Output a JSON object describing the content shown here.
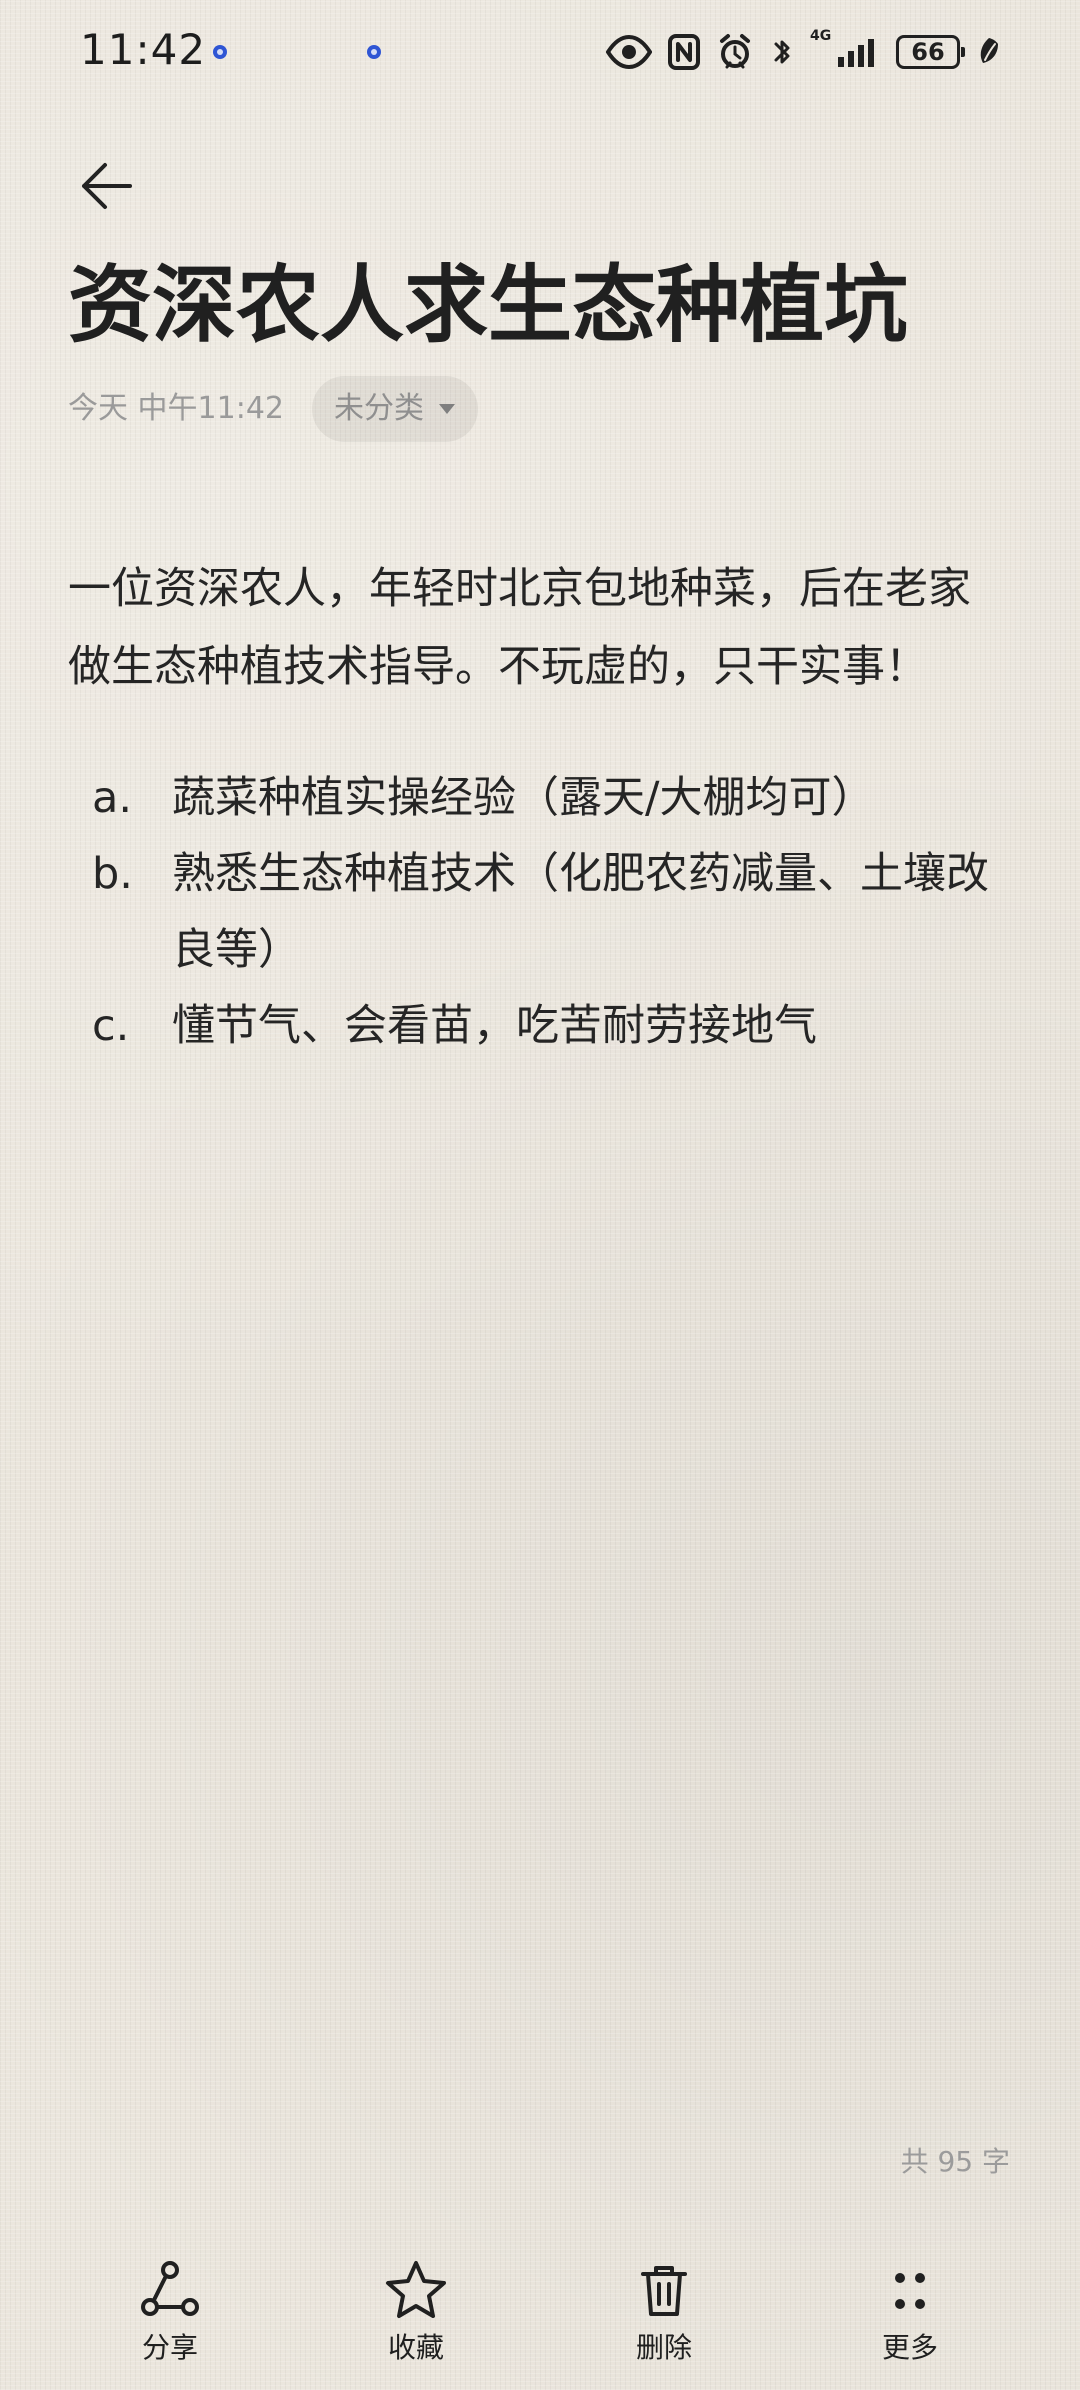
{
  "status_bar": {
    "time": "11:42",
    "network": "4G",
    "battery": "66",
    "icons": [
      "location-dot-icon",
      "eye-icon",
      "nfc-icon",
      "alarm-icon",
      "bluetooth-icon",
      "signal-icon",
      "battery-icon",
      "leaf-icon"
    ]
  },
  "header": {
    "back_icon": "back-arrow-icon"
  },
  "note": {
    "title": "资深农人求生态种植坑",
    "date": "今天 中午11:42",
    "category": "未分类",
    "body": "一位资深农人，年轻时北京包地种菜，后在老家做生态种植技术指导。不玩虚的，只干实事！",
    "items": [
      {
        "marker": "a.",
        "text": "蔬菜种植实操经验（露天/大棚均可）"
      },
      {
        "marker": "b.",
        "text": "熟悉生态种植技术（化肥农药减量、土壤改良等）"
      },
      {
        "marker": "c.",
        "text": "懂节气、会看苗，吃苦耐劳接地气"
      }
    ],
    "word_count": "共 95 字"
  },
  "bottom_bar": {
    "actions": [
      {
        "name": "share",
        "label": "分享",
        "icon": "share-icon"
      },
      {
        "name": "favorite",
        "label": "收藏",
        "icon": "star-icon"
      },
      {
        "name": "delete",
        "label": "删除",
        "icon": "trash-icon"
      },
      {
        "name": "more",
        "label": "更多",
        "icon": "more-grid-icon"
      }
    ]
  },
  "colors": {
    "background": "#ebe6dd",
    "text": "#1f1f1f",
    "secondary_text": "#9a9a9a",
    "chip_background": "#e1dcd3",
    "accent_dot": "#2f55d4"
  }
}
